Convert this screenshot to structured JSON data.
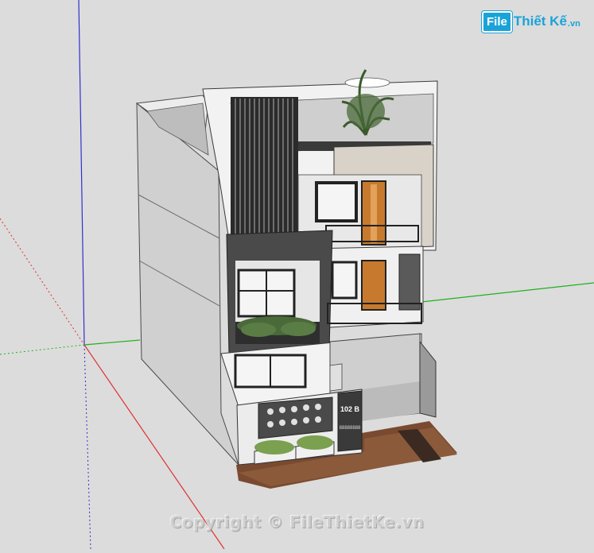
{
  "viewport": {
    "background": "#dcdcdc",
    "red_axis": "#e03030",
    "green_axis": "#20b020",
    "blue_axis": "#3030d0"
  },
  "model": {
    "house_number": "102 B",
    "plate_subtitle": "88888888"
  },
  "logo": {
    "box": "File",
    "name": "Thiết Kế",
    "suffix": ".vn",
    "color": "#1aa3d9"
  },
  "watermark": {
    "text": "Copyright © FileThietKe.vn"
  }
}
